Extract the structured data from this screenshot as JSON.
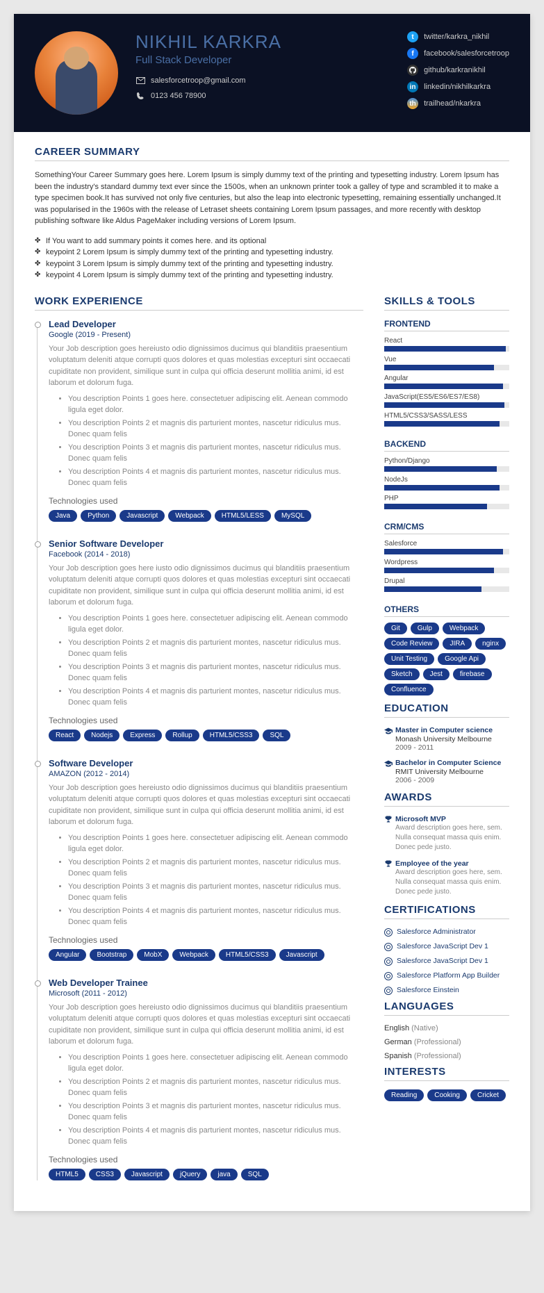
{
  "header": {
    "name": "NIKHIL KARKRA",
    "title": "Full Stack Developer",
    "email": "salesforcetroop@gmail.com",
    "phone": "0123 456 78900"
  },
  "socials": [
    {
      "icon": "twitter",
      "text": "twitter/karkra_nikhil"
    },
    {
      "icon": "facebook",
      "text": "facebook/salesforcetroop"
    },
    {
      "icon": "github",
      "text": "github/karkranikhil"
    },
    {
      "icon": "linkedin",
      "text": "linkedin/nikhilkarkra"
    },
    {
      "icon": "trailhead",
      "text": "trailhead/nkarkra"
    }
  ],
  "sections": {
    "summary": "CAREER SUMMARY",
    "work": "WORK EXPERIENCE",
    "skills": "SKILLS & TOOLS",
    "education": "EDUCATION",
    "awards": "AWARDS",
    "certifications": "CERTIFICATIONS",
    "languages": "LANGUAGES",
    "interests": "INTERESTS"
  },
  "summary": {
    "text": "SomethingYour Career Summary goes here. Lorem Ipsum is simply dummy text of the printing and typesetting industry. Lorem Ipsum has been the industry's standard dummy text ever since the 1500s, when an unknown printer took a galley of type and scrambled it to make a type specimen book.It has survived not only five centuries, but also the leap into electronic typesetting, remaining essentially unchanged.It was popularised in the 1960s with the release of Letraset sheets containing Lorem Ipsum passages, and more recently with desktop publishing software like Aldus PageMaker including versions of Lorem Ipsum.",
    "points": [
      "If You want to add summary points it comes here. and its optional",
      "keypoint 2 Lorem Ipsum is simply dummy text of the printing and typesetting industry.",
      "keypoint 3 Lorem Ipsum is simply dummy text of the printing and typesetting industry.",
      "keypoint 4 Lorem Ipsum is simply dummy text of the printing and typesetting industry."
    ]
  },
  "jobs": [
    {
      "title": "Lead Developer",
      "company": "Google (2019 - Present)",
      "desc": "Your Job description goes hereiusto odio dignissimos ducimus qui blanditiis praesentium voluptatum deleniti atque corrupti quos dolores et quas molestias excepturi sint occaecati cupiditate non provident, similique sunt in culpa qui officia deserunt mollitia animi, id est laborum et dolorum fuga.",
      "points": [
        "You description Points 1 goes here. consectetuer adipiscing elit. Aenean commodo ligula eget dolor.",
        "You description Points 2 et magnis dis parturient montes, nascetur ridiculus mus. Donec quam felis",
        "You description Points 3 et magnis dis parturient montes, nascetur ridiculus mus. Donec quam felis",
        "You description Points 4 et magnis dis parturient montes, nascetur ridiculus mus. Donec quam felis"
      ],
      "tech_label": "Technologies used",
      "tech": [
        "Java",
        "Python",
        "Javascript",
        "Webpack",
        "HTML5/LESS",
        "MySQL"
      ]
    },
    {
      "title": "Senior Software Developer",
      "company": "Facebook (2014 - 2018)",
      "desc": "Your Job description goes here iusto odio dignissimos ducimus qui blanditiis praesentium voluptatum deleniti atque corrupti quos dolores et quas molestias excepturi sint occaecati cupiditate non provident, similique sunt in culpa qui officia deserunt mollitia animi, id est laborum et dolorum fuga.",
      "points": [
        "You description Points 1 goes here. consectetuer adipiscing elit. Aenean commodo ligula eget dolor.",
        "You description Points 2 et magnis dis parturient montes, nascetur ridiculus mus. Donec quam felis",
        "You description Points 3 et magnis dis parturient montes, nascetur ridiculus mus. Donec quam felis",
        "You description Points 4 et magnis dis parturient montes, nascetur ridiculus mus. Donec quam felis"
      ],
      "tech_label": "Technologies used",
      "tech": [
        "React",
        "Nodejs",
        "Express",
        "Rollup",
        "HTML5/CSS3",
        "SQL"
      ]
    },
    {
      "title": "Software Developer",
      "company": "AMAZON (2012 - 2014)",
      "desc": "Your Job description goes hereiusto odio dignissimos ducimus qui blanditiis praesentium voluptatum deleniti atque corrupti quos dolores et quas molestias excepturi sint occaecati cupiditate non provident, similique sunt in culpa qui officia deserunt mollitia animi, id est laborum et dolorum fuga.",
      "points": [
        "You description Points 1 goes here. consectetuer adipiscing elit. Aenean commodo ligula eget dolor.",
        "You description Points 2 et magnis dis parturient montes, nascetur ridiculus mus. Donec quam felis",
        "You description Points 3 et magnis dis parturient montes, nascetur ridiculus mus. Donec quam felis",
        "You description Points 4 et magnis dis parturient montes, nascetur ridiculus mus. Donec quam felis"
      ],
      "tech_label": "Technologies used",
      "tech": [
        "Angular",
        "Bootstrap",
        "MobX",
        "Webpack",
        "HTML5/CSS3",
        "Javascript"
      ]
    },
    {
      "title": "Web Developer Trainee",
      "company": "Microsoft (2011 - 2012)",
      "desc": "Your Job description goes hereiusto odio dignissimos ducimus qui blanditiis praesentium voluptatum deleniti atque corrupti quos dolores et quas molestias excepturi sint occaecati cupiditate non provident, similique sunt in culpa qui officia deserunt mollitia animi, id est laborum et dolorum fuga.",
      "points": [
        "You description Points 1 goes here. consectetuer adipiscing elit. Aenean commodo ligula eget dolor.",
        "You description Points 2 et magnis dis parturient montes, nascetur ridiculus mus. Donec quam felis",
        "You description Points 3 et magnis dis parturient montes, nascetur ridiculus mus. Donec quam felis",
        "You description Points 4 et magnis dis parturient montes, nascetur ridiculus mus. Donec quam felis"
      ],
      "tech_label": "Technologies used",
      "tech": [
        "HTML5",
        "CSS3",
        "Javascript",
        "jQuery",
        "java",
        "SQL"
      ]
    }
  ],
  "skills": {
    "groups": [
      {
        "title": "FRONTEND",
        "items": [
          {
            "name": "React",
            "pct": 97
          },
          {
            "name": "Vue",
            "pct": 88
          },
          {
            "name": "Angular",
            "pct": 95
          },
          {
            "name": "JavaScript(ES5/ES6/ES7/ES8)",
            "pct": 96
          },
          {
            "name": "HTML5/CSS3/SASS/LESS",
            "pct": 92
          }
        ]
      },
      {
        "title": "BACKEND",
        "items": [
          {
            "name": "Python/Django",
            "pct": 90
          },
          {
            "name": "NodeJs",
            "pct": 92
          },
          {
            "name": "PHP",
            "pct": 82
          }
        ]
      },
      {
        "title": "CRM/CMS",
        "items": [
          {
            "name": "Salesforce",
            "pct": 95
          },
          {
            "name": "Wordpress",
            "pct": 88
          },
          {
            "name": "Drupal",
            "pct": 78
          }
        ]
      }
    ],
    "others_title": "OTHERS",
    "others": [
      "Git",
      "Gulp",
      "Webpack",
      "Code Review",
      "JIRA",
      "nginx",
      "Unit Testing",
      "Google Api",
      "Sketch",
      "Jest",
      "firebase",
      "Confluence"
    ]
  },
  "education": [
    {
      "degree": "Master in Computer science",
      "school": "Monash University Melbourne",
      "dates": "2009 - 2011"
    },
    {
      "degree": "Bachelor in Computer Science",
      "school": "RMIT University Melbourne",
      "dates": "2006 - 2009"
    }
  ],
  "awards": [
    {
      "name": "Microsoft MVP",
      "desc": "Award description goes here, sem. Nulla consequat massa quis enim. Donec pede justo."
    },
    {
      "name": "Employee of the year",
      "desc": "Award description goes here, sem. Nulla consequat massa quis enim. Donec pede justo."
    }
  ],
  "certifications": [
    "Salesforce Administrator",
    "Salesforce JavaScript Dev 1",
    "Salesforce JavaScript Dev 1",
    "Salesforce Platform App Builder",
    "Salesforce Einstein"
  ],
  "languages": [
    {
      "name": "English",
      "level": "Native"
    },
    {
      "name": "German",
      "level": "Professional"
    },
    {
      "name": "Spanish",
      "level": "Professional"
    }
  ],
  "interests": [
    "Reading",
    "Cooking",
    "Cricket"
  ]
}
